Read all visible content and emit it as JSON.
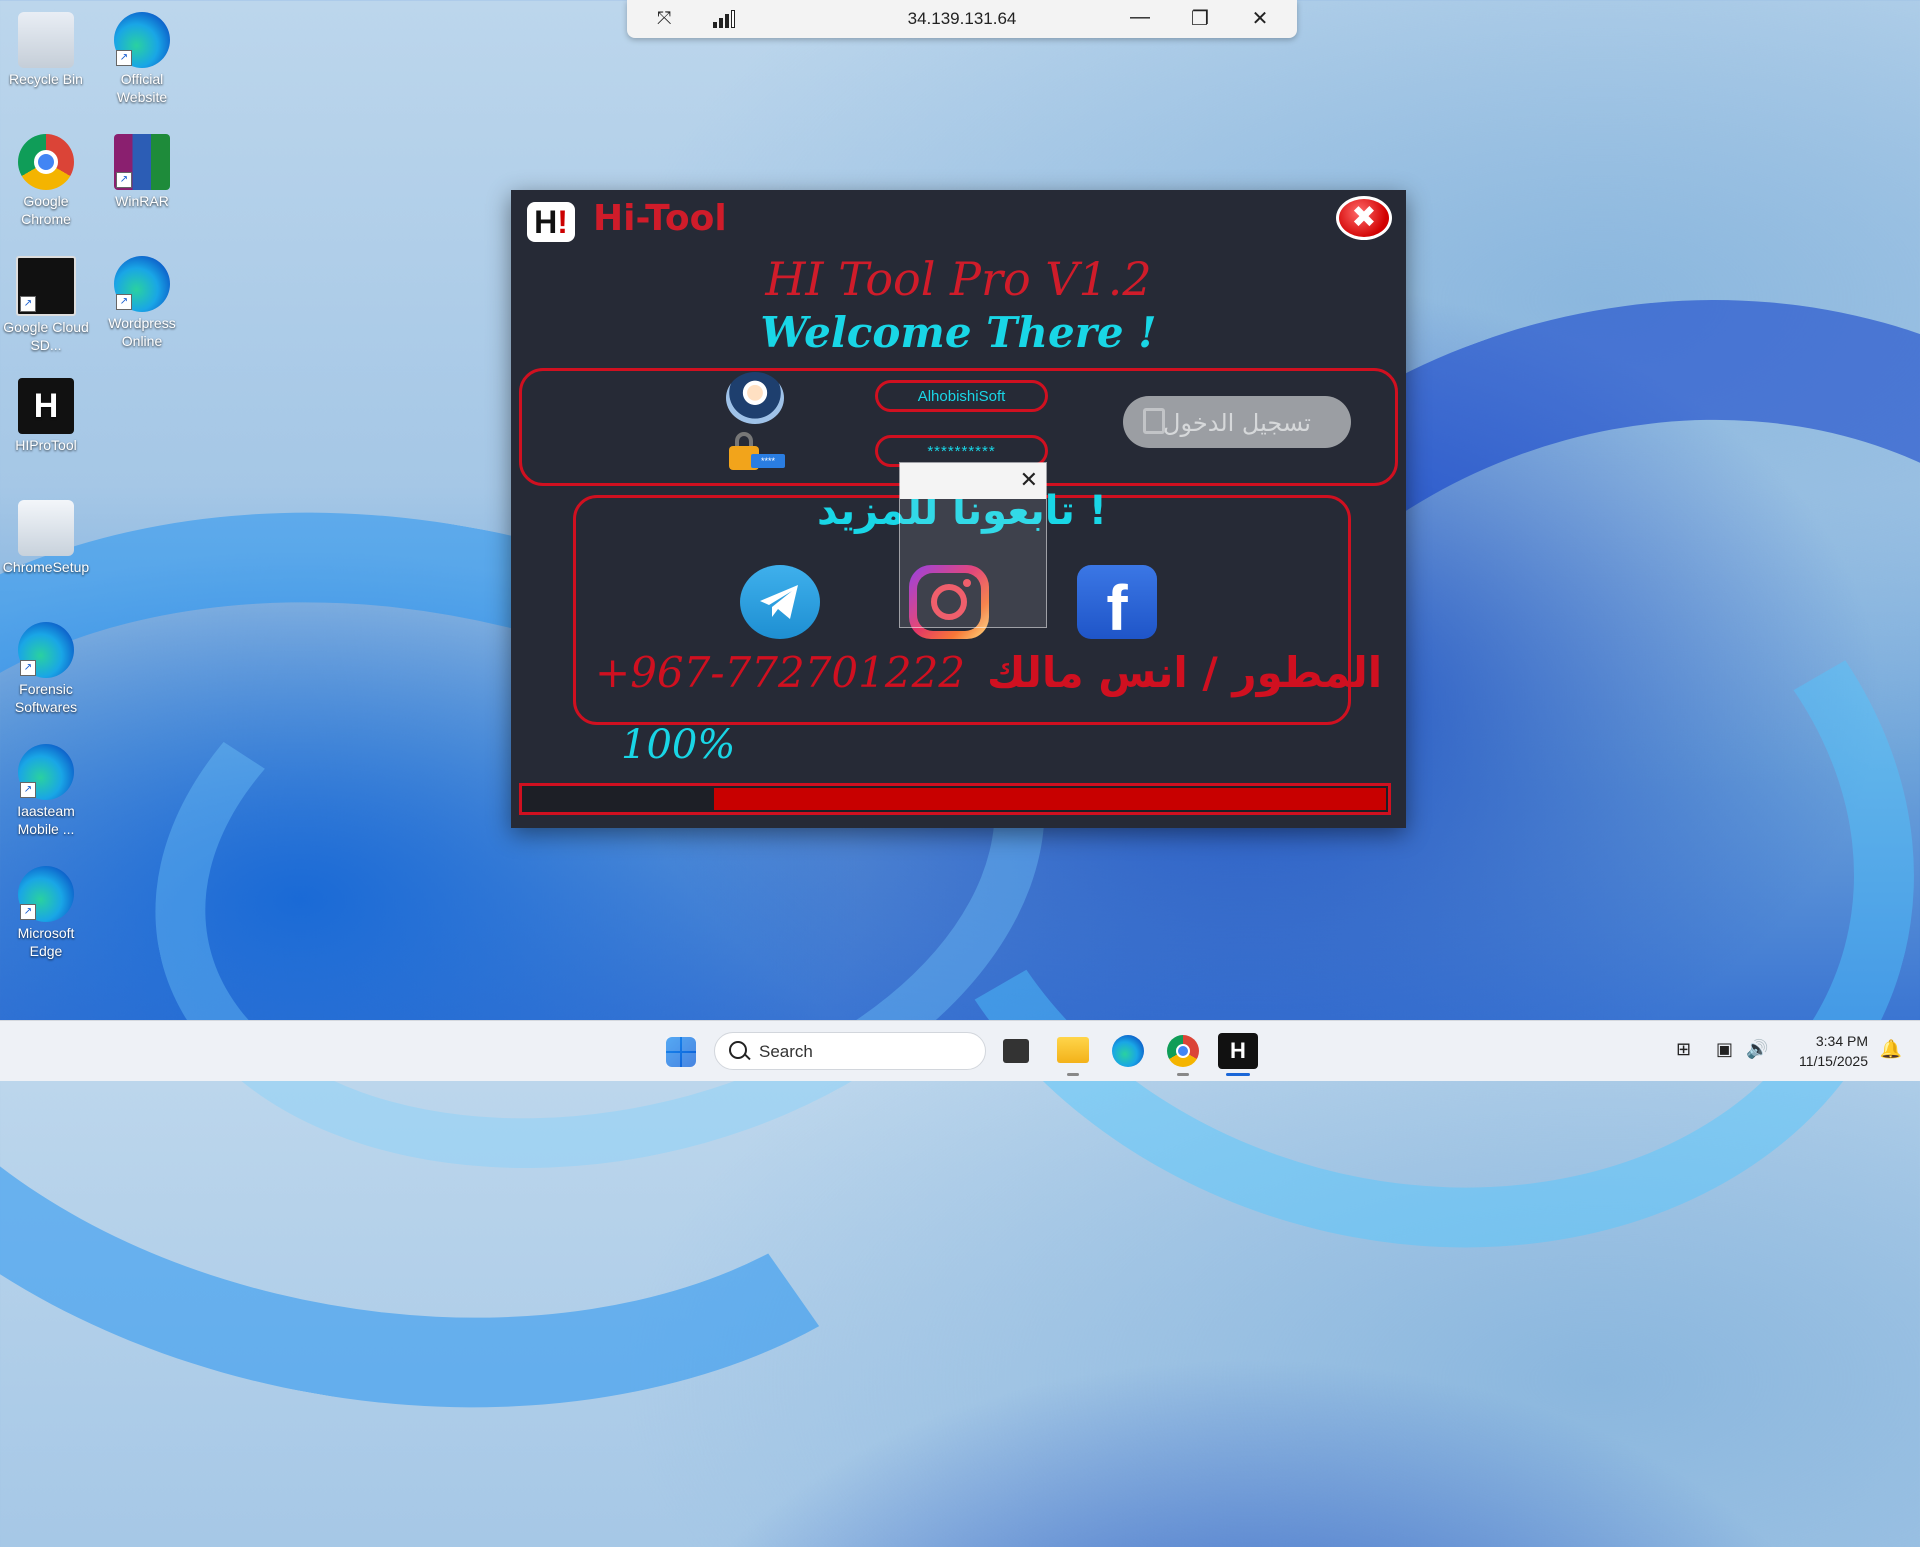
{
  "desktop": {
    "icons": [
      {
        "label": "Recycle Bin",
        "icon": "recycle-bin-icon"
      },
      {
        "label": "Official Website",
        "icon": "edge-icon"
      },
      {
        "label": "Google Chrome",
        "icon": "chrome-icon"
      },
      {
        "label": "WinRAR",
        "icon": "winrar-icon"
      },
      {
        "label": "Google Cloud SD...",
        "icon": "terminal-icon"
      },
      {
        "label": "Wordpress Online",
        "icon": "edge-icon"
      },
      {
        "label": "HIProTool",
        "icon": "hiprotool-icon"
      },
      {
        "label": "ChromeSetup",
        "icon": "setup-icon"
      },
      {
        "label": "Forensic Softwares",
        "icon": "edge-icon"
      },
      {
        "label": "Iaasteam Mobile ...",
        "icon": "edge-icon"
      },
      {
        "label": "Microsoft Edge",
        "icon": "edge-icon"
      }
    ]
  },
  "remote_bar": {
    "ip": "34.139.131.64",
    "pin_glyph": "⤧",
    "minimize_glyph": "—",
    "restore_glyph": "❐",
    "close_glyph": "✕"
  },
  "app": {
    "logo_text": "H",
    "logo_suffix": "!",
    "title": "Hi-Tool",
    "close_glyph": "✖",
    "version_heading": "HI Tool Pro V1.2",
    "welcome": "Welcome There !",
    "username": "AlhobishiSoft",
    "password_mask": "**********",
    "password_badge": "****",
    "login_label": "تسجيل الدخول",
    "follow_text": "تابعونا للمزيد !",
    "facebook_glyph": "f",
    "phone": "+967-772701222",
    "developer": "المطور / انس مالك",
    "progress_text": "100%",
    "progress_value": 0.78,
    "accent_red": "#d01020",
    "accent_cyan": "#19d6e6"
  },
  "popup": {
    "close_glyph": "✕"
  },
  "taskbar": {
    "search_label": "Search",
    "time": "3:34 PM",
    "date": "11/15/2025",
    "hi_glyph": "H",
    "tray_network_glyph": "⊞",
    "tray_volume_glyph": "🔊",
    "tray_monitor_glyph": "▣",
    "bell_glyph": "🔔"
  }
}
